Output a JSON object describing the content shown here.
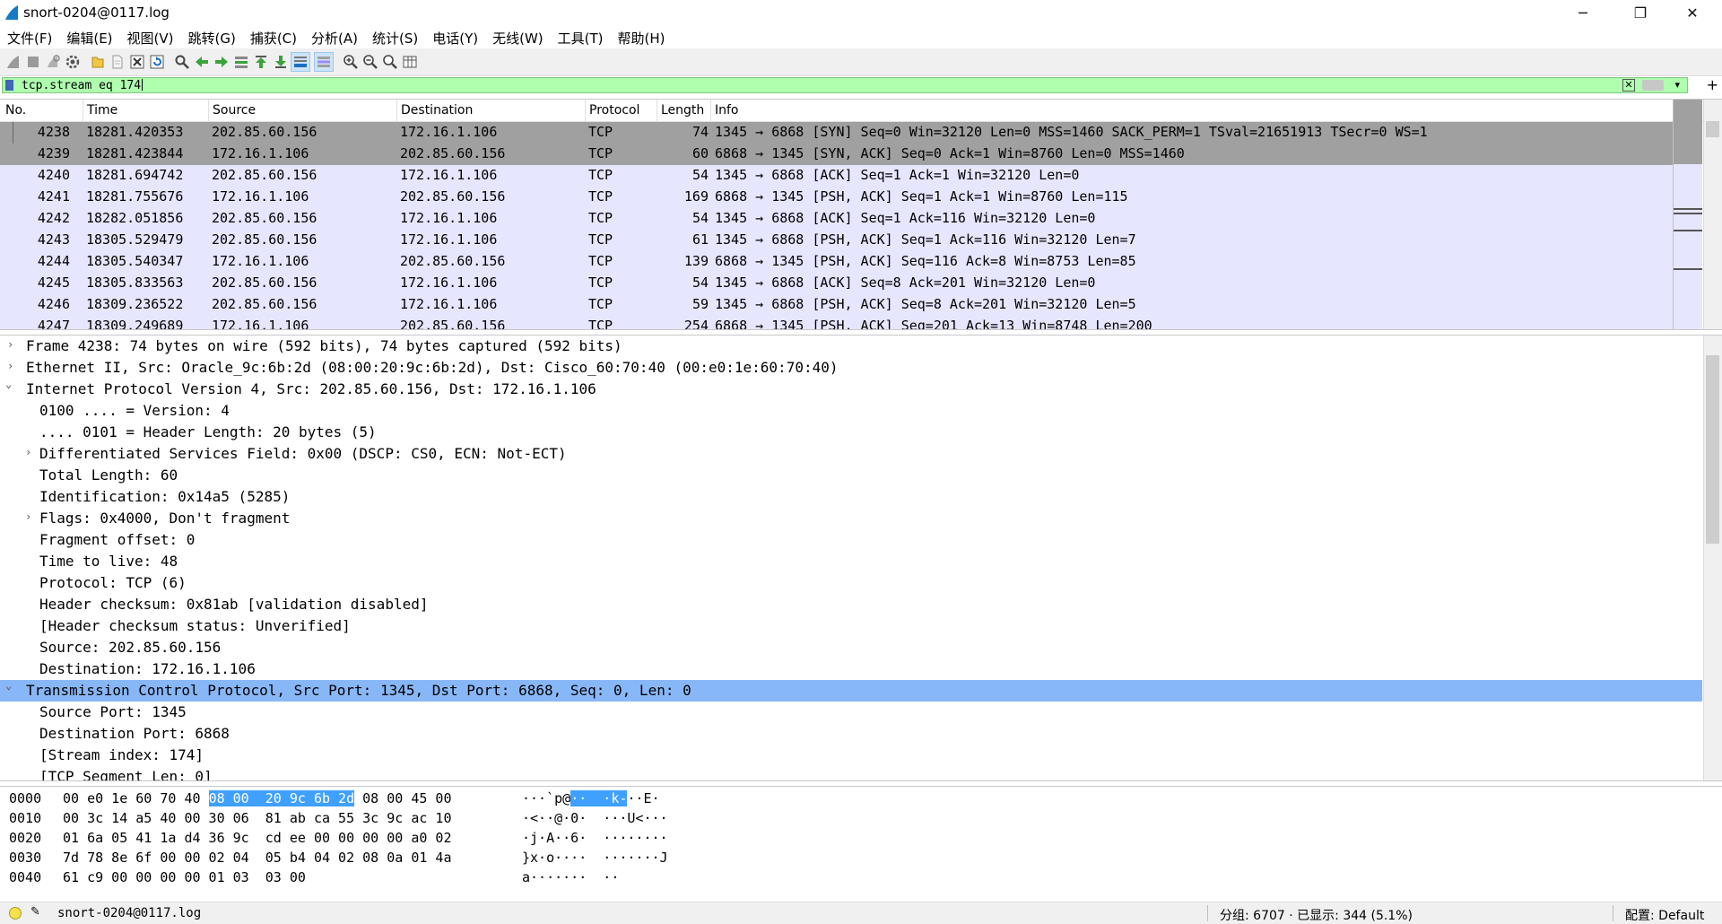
{
  "window": {
    "title": "snort-0204@0117.log",
    "minimize_glyph": "─",
    "restore_glyph": "❐",
    "close_glyph": "✕"
  },
  "menu": [
    "文件(F)",
    "编辑(E)",
    "视图(V)",
    "跳转(G)",
    "捕获(C)",
    "分析(A)",
    "统计(S)",
    "电话(Y)",
    "无线(W)",
    "工具(T)",
    "帮助(H)"
  ],
  "filter": {
    "value": "tcp.stream eq 174",
    "clear_glyph": "✕",
    "dropdown_glyph": "▾",
    "add_glyph": "+"
  },
  "packet_list": {
    "columns": [
      "No.",
      "Time",
      "Source",
      "Destination",
      "Protocol",
      "Length",
      "Info"
    ],
    "rows": [
      {
        "no": "4238",
        "time": "18281.420353",
        "src": "202.85.60.156",
        "dst": "172.16.1.106",
        "proto": "TCP",
        "len": "74",
        "info": "1345 → 6868 [SYN] Seq=0 Win=32120 Len=0 MSS=1460 SACK_PERM=1 TSval=21651913 TSecr=0 WS=1"
      },
      {
        "no": "4239",
        "time": "18281.423844",
        "src": "172.16.1.106",
        "dst": "202.85.60.156",
        "proto": "TCP",
        "len": "60",
        "info": "6868 → 1345 [SYN, ACK] Seq=0 Ack=1 Win=8760 Len=0 MSS=1460"
      },
      {
        "no": "4240",
        "time": "18281.694742",
        "src": "202.85.60.156",
        "dst": "172.16.1.106",
        "proto": "TCP",
        "len": "54",
        "info": "1345 → 6868 [ACK] Seq=1 Ack=1 Win=32120 Len=0"
      },
      {
        "no": "4241",
        "time": "18281.755676",
        "src": "172.16.1.106",
        "dst": "202.85.60.156",
        "proto": "TCP",
        "len": "169",
        "info": "6868 → 1345 [PSH, ACK] Seq=1 Ack=1 Win=8760 Len=115"
      },
      {
        "no": "4242",
        "time": "18282.051856",
        "src": "202.85.60.156",
        "dst": "172.16.1.106",
        "proto": "TCP",
        "len": "54",
        "info": "1345 → 6868 [ACK] Seq=1 Ack=116 Win=32120 Len=0"
      },
      {
        "no": "4243",
        "time": "18305.529479",
        "src": "202.85.60.156",
        "dst": "172.16.1.106",
        "proto": "TCP",
        "len": "61",
        "info": "1345 → 6868 [PSH, ACK] Seq=1 Ack=116 Win=32120 Len=7"
      },
      {
        "no": "4244",
        "time": "18305.540347",
        "src": "172.16.1.106",
        "dst": "202.85.60.156",
        "proto": "TCP",
        "len": "139",
        "info": "6868 → 1345 [PSH, ACK] Seq=116 Ack=8 Win=8753 Len=85"
      },
      {
        "no": "4245",
        "time": "18305.833563",
        "src": "202.85.60.156",
        "dst": "172.16.1.106",
        "proto": "TCP",
        "len": "54",
        "info": "1345 → 6868 [ACK] Seq=8 Ack=201 Win=32120 Len=0"
      },
      {
        "no": "4246",
        "time": "18309.236522",
        "src": "202.85.60.156",
        "dst": "172.16.1.106",
        "proto": "TCP",
        "len": "59",
        "info": "1345 → 6868 [PSH, ACK] Seq=8 Ack=201 Win=32120 Len=5"
      },
      {
        "no": "4247",
        "time": "18309.249689",
        "src": "172.16.1.106",
        "dst": "202.85.60.156",
        "proto": "TCP",
        "len": "254",
        "info": "6868 → 1345 [PSH, ACK] Seq=201 Ack=13 Win=8748 Len=200"
      }
    ]
  },
  "details": [
    {
      "indent": 0,
      "arrow": "›",
      "text": "Frame 4238: 74 bytes on wire (592 bits), 74 bytes captured (592 bits)"
    },
    {
      "indent": 0,
      "arrow": "›",
      "text": "Ethernet II, Src: Oracle_9c:6b:2d (08:00:20:9c:6b:2d), Dst: Cisco_60:70:40 (00:e0:1e:60:70:40)"
    },
    {
      "indent": 0,
      "arrow": "⌄",
      "text": "Internet Protocol Version 4, Src: 202.85.60.156, Dst: 172.16.1.106"
    },
    {
      "indent": 1,
      "arrow": "",
      "text": "0100 .... = Version: 4"
    },
    {
      "indent": 1,
      "arrow": "",
      "text": ".... 0101 = Header Length: 20 bytes (5)"
    },
    {
      "indent": 1,
      "arrow": "›",
      "text": "Differentiated Services Field: 0x00 (DSCP: CS0, ECN: Not-ECT)"
    },
    {
      "indent": 1,
      "arrow": "",
      "text": "Total Length: 60"
    },
    {
      "indent": 1,
      "arrow": "",
      "text": "Identification: 0x14a5 (5285)"
    },
    {
      "indent": 1,
      "arrow": "›",
      "text": "Flags: 0x4000, Don't fragment"
    },
    {
      "indent": 1,
      "arrow": "",
      "text": "Fragment offset: 0"
    },
    {
      "indent": 1,
      "arrow": "",
      "text": "Time to live: 48"
    },
    {
      "indent": 1,
      "arrow": "",
      "text": "Protocol: TCP (6)"
    },
    {
      "indent": 1,
      "arrow": "",
      "text": "Header checksum: 0x81ab [validation disabled]"
    },
    {
      "indent": 1,
      "arrow": "",
      "text": "[Header checksum status: Unverified]"
    },
    {
      "indent": 1,
      "arrow": "",
      "text": "Source: 202.85.60.156"
    },
    {
      "indent": 1,
      "arrow": "",
      "text": "Destination: 172.16.1.106"
    },
    {
      "indent": 0,
      "arrow": "⌄",
      "text": "Transmission Control Protocol, Src Port: 1345, Dst Port: 6868, Seq: 0, Len: 0",
      "selected": true
    },
    {
      "indent": 1,
      "arrow": "",
      "text": "Source Port: 1345"
    },
    {
      "indent": 1,
      "arrow": "",
      "text": "Destination Port: 6868"
    },
    {
      "indent": 1,
      "arrow": "",
      "text": "[Stream index: 174]"
    },
    {
      "indent": 1,
      "arrow": "",
      "text": "[TCP Segment Len: 0]"
    }
  ],
  "hex": [
    {
      "off": "0000",
      "pre": "00 e0 1e 60 70 40 ",
      "hl": "08 00  20 9c 6b 2d",
      "post": " 08 00 45 00",
      "apre": "···`p@",
      "ahl": "··  ·k-",
      "apost": "··E·"
    },
    {
      "off": "0010",
      "pre": "00 3c 14 a5 40 00 30 06  81 ab ca 55 3c 9c ac 10",
      "hl": "",
      "post": "",
      "apre": "·<··@·0·  ···U<···",
      "ahl": "",
      "apost": ""
    },
    {
      "off": "0020",
      "pre": "01 6a 05 41 1a d4 36 9c  cd ee 00 00 00 00 a0 02",
      "hl": "",
      "post": "",
      "apre": "·j·A··6·  ········",
      "ahl": "",
      "apost": ""
    },
    {
      "off": "0030",
      "pre": "7d 78 8e 6f 00 00 02 04  05 b4 04 02 08 0a 01 4a",
      "hl": "",
      "post": "",
      "apre": "}x·o····  ·······J",
      "ahl": "",
      "apost": ""
    },
    {
      "off": "0040",
      "pre": "61 c9 00 00 00 00 01 03  03 00",
      "hl": "",
      "post": "",
      "apre": "a·······  ··",
      "ahl": "",
      "apost": ""
    }
  ],
  "status": {
    "file": "snort-0204@0117.log",
    "stats": "分组: 6707 · 已显示: 344 (5.1%)",
    "profile": "配置: Default"
  },
  "colors": {
    "filter_bg": "#afffaf",
    "row_tcp": "#e7e6ff",
    "row_syn": "#a0a0a0",
    "selected": "#88b7f7",
    "hex_highlight": "#3fa0ff"
  }
}
